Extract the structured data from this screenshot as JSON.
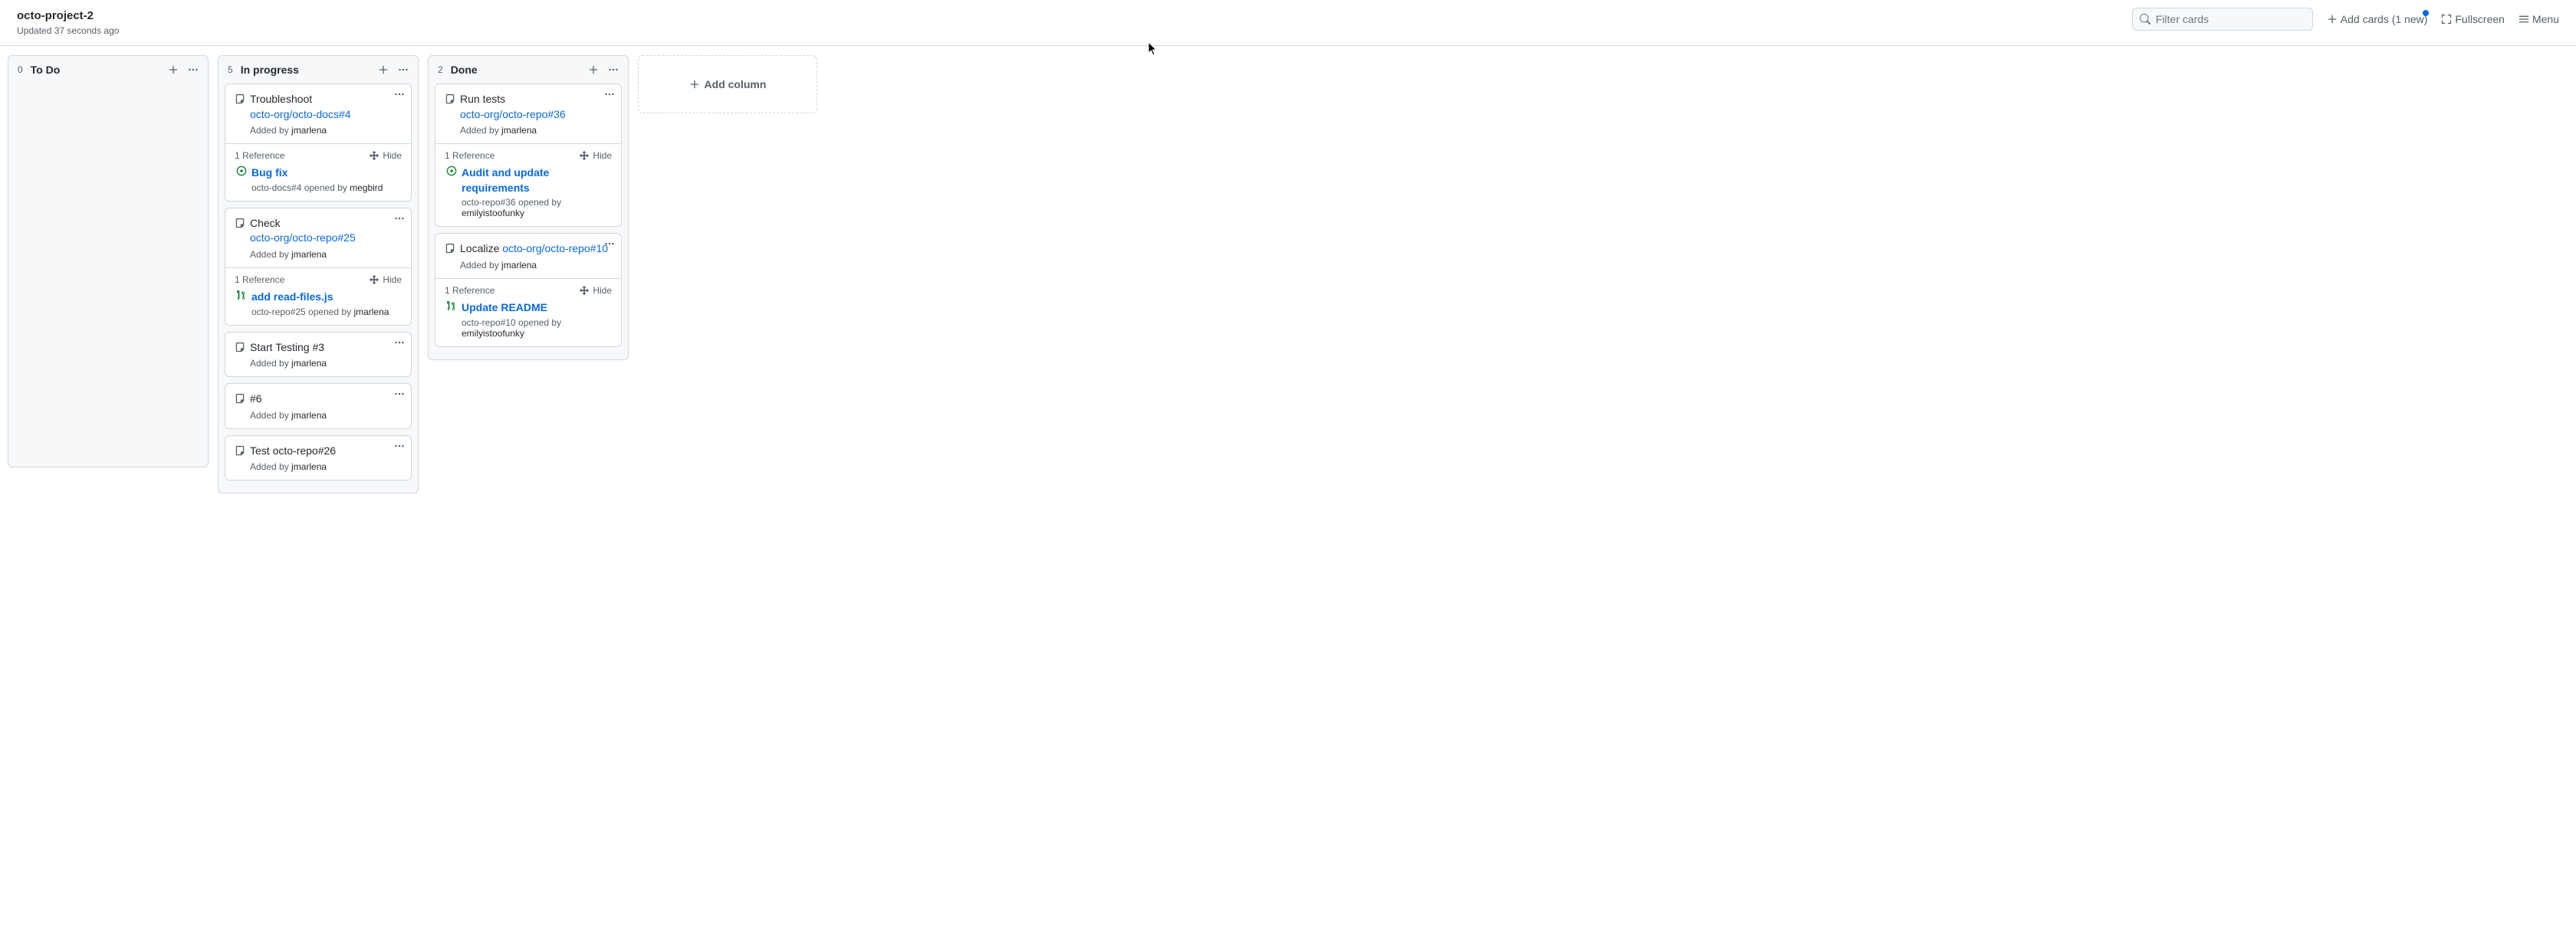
{
  "header": {
    "title": "octo-project-2",
    "subtitle": "Updated 37 seconds ago",
    "search_placeholder": "Filter cards",
    "add_cards": "Add cards (1 new)",
    "fullscreen": "Fullscreen",
    "menu": "Menu"
  },
  "add_column_label": "Add column",
  "columns": [
    {
      "count": "0",
      "name": "To Do",
      "cards": []
    },
    {
      "count": "5",
      "name": "In progress",
      "cards": [
        {
          "title_text": "Troubleshoot",
          "title_link": "octo-org/octo-docs#4",
          "added_by_prefix": "Added by",
          "added_by": "jmarlena",
          "ref_count": "1 Reference",
          "hide": "Hide",
          "ref_type": "issue-open",
          "ref_title": "Bug fix",
          "ref_meta_text": "octo-docs#4 opened by",
          "ref_user": "megbird"
        },
        {
          "title_text": "Check",
          "title_link": "octo-org/octo-repo#25",
          "added_by_prefix": "Added by",
          "added_by": "jmarlena",
          "ref_count": "1 Reference",
          "hide": "Hide",
          "ref_type": "pr-open",
          "ref_title": "add read-files.js",
          "ref_meta_text": "octo-repo#25 opened by",
          "ref_user": "jmarlena"
        },
        {
          "title_text": "Start Testing #3",
          "title_link": "",
          "added_by_prefix": "Added by",
          "added_by": "jmarlena"
        },
        {
          "title_text": "#6",
          "title_link": "",
          "added_by_prefix": "Added by",
          "added_by": "jmarlena"
        },
        {
          "title_text": "Test octo-repo#26",
          "title_link": "",
          "added_by_prefix": "Added by",
          "added_by": "jmarlena"
        }
      ]
    },
    {
      "count": "2",
      "name": "Done",
      "cards": [
        {
          "title_text": "Run tests",
          "title_link": "octo-org/octo-repo#36",
          "added_by_prefix": "Added by",
          "added_by": "jmarlena",
          "ref_count": "1 Reference",
          "hide": "Hide",
          "ref_type": "issue-open",
          "ref_title": "Audit and update requirements",
          "ref_meta_text": "octo-repo#36 opened by",
          "ref_user": "emilyistoofunky"
        },
        {
          "title_text": "Localize",
          "title_link": "octo-org/octo-repo#10",
          "title_inline": true,
          "added_by_prefix": "Added by",
          "added_by": "jmarlena",
          "ref_count": "1 Reference",
          "hide": "Hide",
          "ref_type": "pr-open",
          "ref_title": "Update README",
          "ref_meta_text": "octo-repo#10 opened by",
          "ref_user": "emilyistoofunky"
        }
      ]
    }
  ]
}
